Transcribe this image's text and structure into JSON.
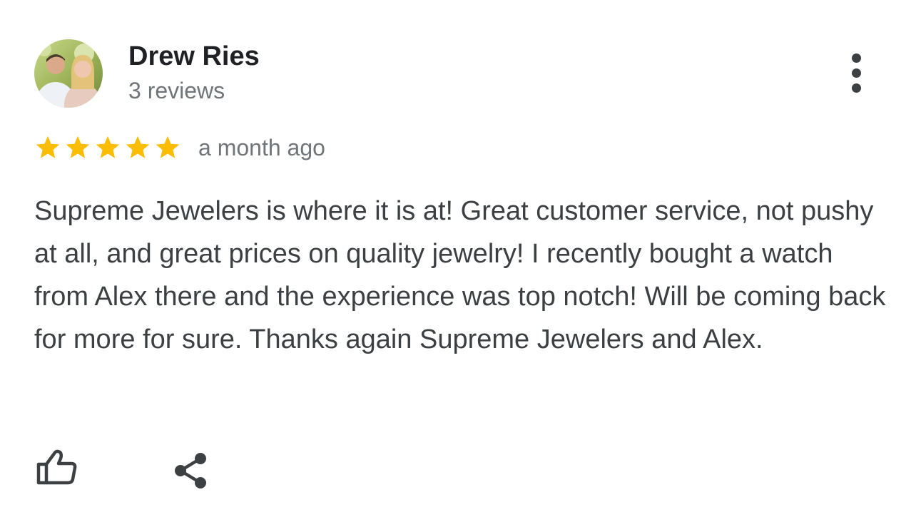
{
  "review": {
    "author_name": "Drew Ries",
    "review_count": "3 reviews",
    "rating": 5,
    "rating_max": 5,
    "time_ago": "a month ago",
    "text": "Supreme Jewelers is where it is at! Great customer service, not pushy at all, and great prices on quality jewelry! I recently bought a watch from Alex there and the experience was top notch! Will be coming back for more for sure. Thanks again Supreme Jewelers and Alex."
  },
  "icons": {
    "more": "more-vert-icon",
    "like": "thumbs-up-icon",
    "share": "share-icon",
    "star": "star-icon"
  },
  "colors": {
    "star": "#fbbc04",
    "icon": "#3c4043",
    "secondary_text": "#70757a",
    "body_text": "#3c4043"
  }
}
